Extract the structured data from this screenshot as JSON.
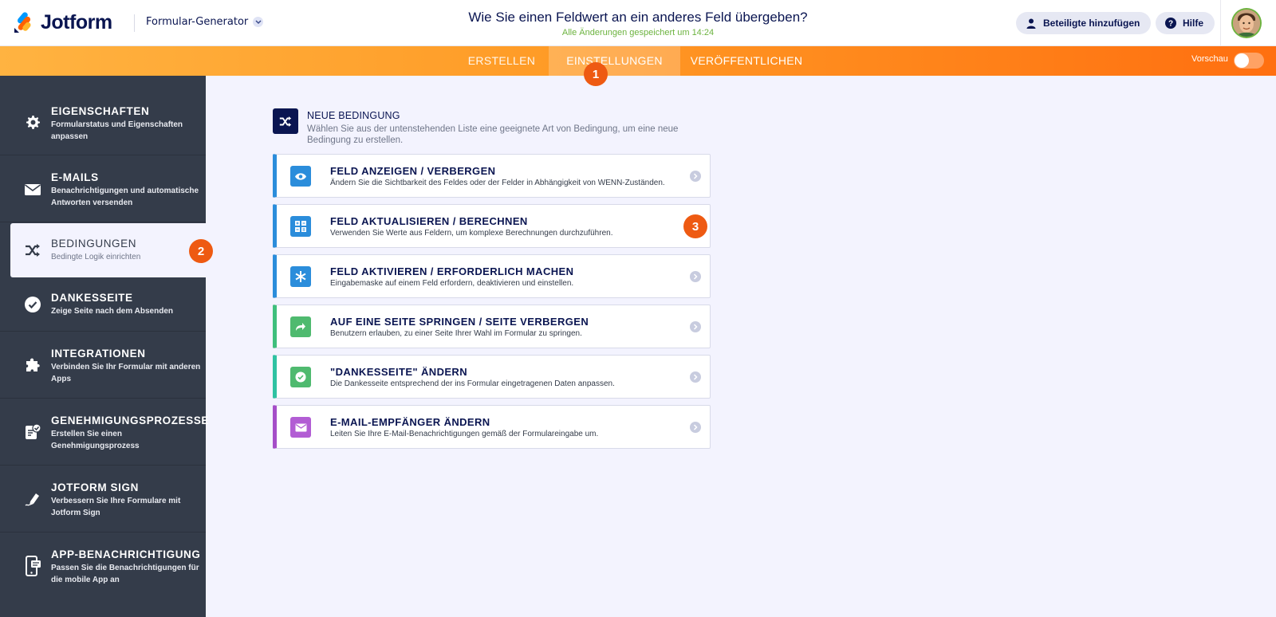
{
  "header": {
    "logo_text": "Jotform",
    "builder_label": "Formular-Generator",
    "form_title": "Wie Sie einen Feldwert an ein anderes Feld übergeben?",
    "saved_status": "Alle Änderungen gespeichert um 14:24",
    "invite_label": "Beteiligte hinzufügen",
    "help_label": "Hilfe"
  },
  "nav": {
    "tabs": [
      {
        "label": "ERSTELLEN"
      },
      {
        "label": "EINSTELLUNGEN"
      },
      {
        "label": "VERÖFFENTLICHEN"
      }
    ],
    "active_tab": "EINSTELLUNGEN",
    "preview_label": "Vorschau"
  },
  "badges": [
    "1",
    "2",
    "3"
  ],
  "sidebar": {
    "items": [
      {
        "title": "EIGENSCHAFTEN",
        "desc": "Formularstatus und Eigenschaften anpassen",
        "icon": "gear-icon"
      },
      {
        "title": "E-MAILS",
        "desc": "Benachrichtigungen und automatische Antworten versenden",
        "icon": "envelope-icon"
      },
      {
        "title": "BEDINGUNGEN",
        "desc": "Bedingte Logik einrichten",
        "icon": "shuffle-icon"
      },
      {
        "title": "DANKESSEITE",
        "desc": "Zeige Seite nach dem Absenden",
        "icon": "check-circle-icon"
      },
      {
        "title": "INTEGRATIONEN",
        "desc": "Verbinden Sie Ihr Formular mit anderen Apps",
        "icon": "puzzle-icon"
      },
      {
        "title": "GENEHMIGUNGSPROZESSE",
        "desc": "Erstellen Sie einen Genehmigungsprozess",
        "icon": "approval-icon"
      },
      {
        "title": "JOTFORM SIGN",
        "desc": "Verbessern Sie Ihre Formulare mit Jotform Sign",
        "icon": "pen-icon"
      },
      {
        "title": "APP-BENACHRICHTIGUNG",
        "desc": "Passen Sie die Benachrichtigungen für die mobile App an",
        "icon": "mobile-icon"
      }
    ],
    "active_item": "BEDINGUNGEN"
  },
  "main": {
    "title": "NEUE BEDINGUNG",
    "desc": "Wählen Sie aus der untenstehenden Liste eine geeignete Art von Bedingung, um eine neue Bedingung zu erstellen.",
    "conditions": [
      {
        "title": "FELD ANZEIGEN / VERBERGEN",
        "desc": "Ändern Sie die Sichtbarkeit des Feldes oder der Felder in Abhängigkeit von WENN-Zuständen.",
        "color": "#2b8ddb",
        "icon": "eye-icon"
      },
      {
        "title": "FELD AKTUALISIEREN / BERECHNEN",
        "desc": "Verwenden Sie Werte aus Feldern, um komplexe Berechnungen durchzuführen.",
        "color": "#2b8ddb",
        "icon": "calculator-icon"
      },
      {
        "title": "FELD AKTIVIEREN / ERFORDERLICH MACHEN",
        "desc": "Eingabemaske auf einem Feld erfordern, deaktivieren und einstellen.",
        "color": "#2b8ddb",
        "icon": "asterisk-icon"
      },
      {
        "title": "AUF EINE SEITE SPRINGEN / SEITE VERBERGEN",
        "desc": "Benutzern erlauben, zu einer Seite Ihrer Wahl im Formular zu springen.",
        "color": "#3fbf7c",
        "icon": "share-arrow-icon"
      },
      {
        "title": "\"DANKESSEITE\" ÄNDERN",
        "desc": "Die Dankesseite entsprechend der ins Formular eingetragenen Daten anpassen.",
        "color": "#2fc2a2",
        "icon": "check-circle-icon"
      },
      {
        "title": "E-MAIL-EMPFÄNGER ÄNDERN",
        "desc": "Leiten Sie Ihre E-Mail-Benachrichtigungen gemäß der Formulareingabe um.",
        "color": "#a54ec8",
        "icon": "envelope-icon"
      }
    ]
  }
}
